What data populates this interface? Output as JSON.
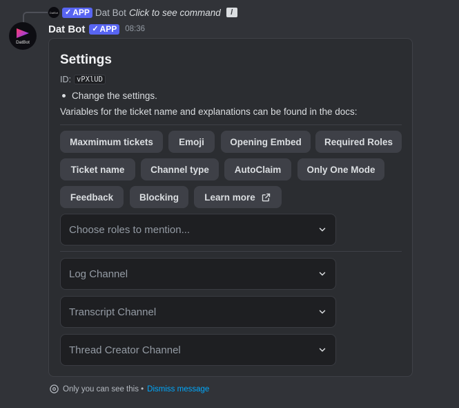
{
  "reply": {
    "avatar_text": "DatBot",
    "app_tag": "APP",
    "author": "Dat Bot",
    "command_text": "Click to see command",
    "command_icon": "slash-command-icon"
  },
  "message": {
    "avatar_text": "DatBot",
    "author": "Dat Bot",
    "app_tag": "APP",
    "timestamp": "08:36"
  },
  "container": {
    "title": "Settings",
    "id_label": "ID:",
    "id_value": "vPXlUD",
    "bullet": "Change the settings.",
    "description": "Variables for the ticket name and explanations can be found in the docs:",
    "buttons": [
      {
        "label": "Maxmimum tickets"
      },
      {
        "label": "Emoji"
      },
      {
        "label": "Opening Embed"
      },
      {
        "label": "Required Roles"
      },
      {
        "label": "Ticket name"
      },
      {
        "label": "Channel type"
      },
      {
        "label": "AutoClaim"
      },
      {
        "label": "Only One Mode"
      },
      {
        "label": "Feedback"
      },
      {
        "label": "Blocking"
      },
      {
        "label": "Learn more",
        "icon": "external-link-icon"
      }
    ],
    "selects": [
      {
        "placeholder": "Choose roles to mention..."
      },
      {
        "placeholder": "Log Channel"
      },
      {
        "placeholder": "Transcript Channel"
      },
      {
        "placeholder": "Thread Creator Channel"
      }
    ]
  },
  "footer": {
    "only_you_text": "Only you can see this •",
    "dismiss_text": "Dismiss message"
  },
  "colors": {
    "background": "#313338",
    "container": "#2b2d31",
    "button": "#3e4047",
    "select": "#1e1f22",
    "app_tag": "#5865f2",
    "link": "#00a8fc"
  }
}
